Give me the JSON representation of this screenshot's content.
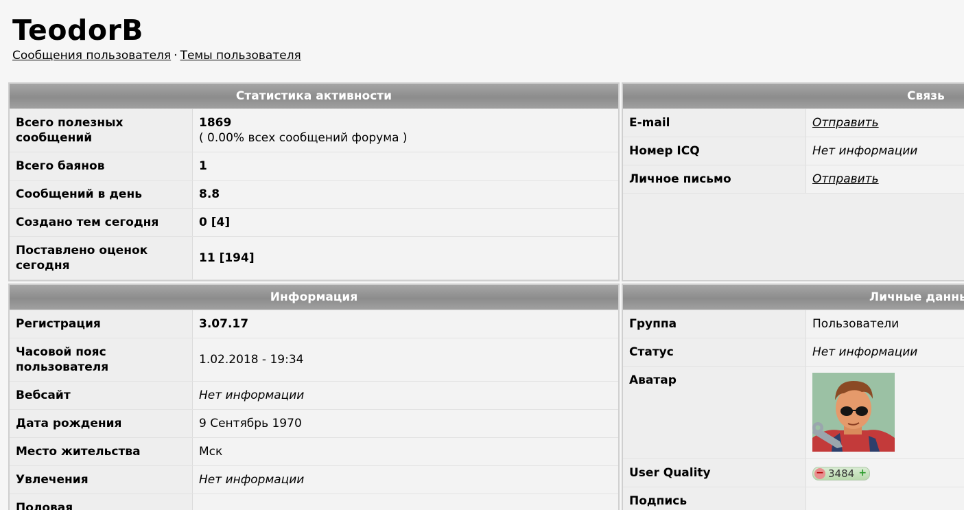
{
  "user": {
    "name": "TeodorB",
    "links": [
      "Сообщения пользователя",
      "Темы пользователя"
    ],
    "separator": "·"
  },
  "stats": {
    "title": "Статистика активности",
    "rows": [
      {
        "key": "Всего полезных сообщений",
        "value": "1869",
        "sub": "( 0.00% всех сообщений форума )"
      },
      {
        "key": "Всего баянов",
        "value": "1"
      },
      {
        "key": "Сообщений в день",
        "value": "8.8"
      },
      {
        "key": "Создано тем сегодня",
        "value": "0 [4]"
      },
      {
        "key": "Поставлено оценок сегодня",
        "value": "11 [194]"
      }
    ]
  },
  "contact": {
    "title": "Связь",
    "rows": [
      {
        "key": "E-mail",
        "value": "Отправить"
      },
      {
        "key": "Номер ICQ",
        "value": "Нет информации"
      },
      {
        "key": "Личное письмо",
        "value": "Отправить"
      }
    ]
  },
  "info": {
    "title": "Информация",
    "rows": [
      {
        "key": "Регистрация",
        "value": "3.07.17"
      },
      {
        "key": "Часовой пояс пользователя",
        "value": "1.02.2018 - 19:34"
      },
      {
        "key": "Вебсайт",
        "value": "Нет информации"
      },
      {
        "key": "Дата рождения",
        "value": "9 Сентябрь 1970"
      },
      {
        "key": "Место жительства",
        "value": "Мск"
      },
      {
        "key": "Увлечения",
        "value": "Нет информации"
      },
      {
        "key": "Половая",
        "value": ""
      }
    ]
  },
  "personal": {
    "title": "Личные данные",
    "rows": [
      {
        "key": "Группа",
        "value": "Пользователи"
      },
      {
        "key": "Статус",
        "value": "Нет информации"
      },
      {
        "key": "Аватар"
      },
      {
        "key": "User Quality"
      },
      {
        "key": "Подпись",
        "value": ""
      }
    ],
    "user_quality": {
      "minus": "−",
      "value": "3484",
      "plus": "+"
    }
  }
}
